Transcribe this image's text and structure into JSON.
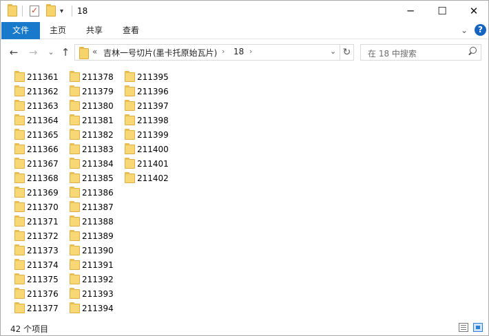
{
  "window": {
    "title": "18",
    "minimize": "─",
    "maximize": "☐",
    "close": "✕"
  },
  "ribbon": {
    "file": "文件",
    "tabs": [
      "主页",
      "共享",
      "查看"
    ],
    "expand_icon": "chevron-down-icon",
    "help": "?"
  },
  "nav": {
    "back": "←",
    "forward": "→",
    "recent": "⌄",
    "up": "↑",
    "breadcrumbs": [
      "吉林一号切片(墨卡托原始瓦片)",
      "18"
    ],
    "overflow": "«",
    "refresh": "↻"
  },
  "search": {
    "placeholder": "在 18 中搜索"
  },
  "folders": {
    "col1": [
      "211361",
      "211362",
      "211363",
      "211364",
      "211365",
      "211366",
      "211367",
      "211368",
      "211369",
      "211370",
      "211371",
      "211372",
      "211373",
      "211374",
      "211375",
      "211376",
      "211377"
    ],
    "col2": [
      "211378",
      "211379",
      "211380",
      "211381",
      "211382",
      "211383",
      "211384",
      "211385",
      "211386",
      "211387",
      "211388",
      "211389",
      "211390",
      "211391",
      "211392",
      "211393",
      "211394"
    ],
    "col3": [
      "211395",
      "211396",
      "211397",
      "211398",
      "211399",
      "211400",
      "211401",
      "211402"
    ]
  },
  "status": {
    "count": "42 个项目"
  }
}
